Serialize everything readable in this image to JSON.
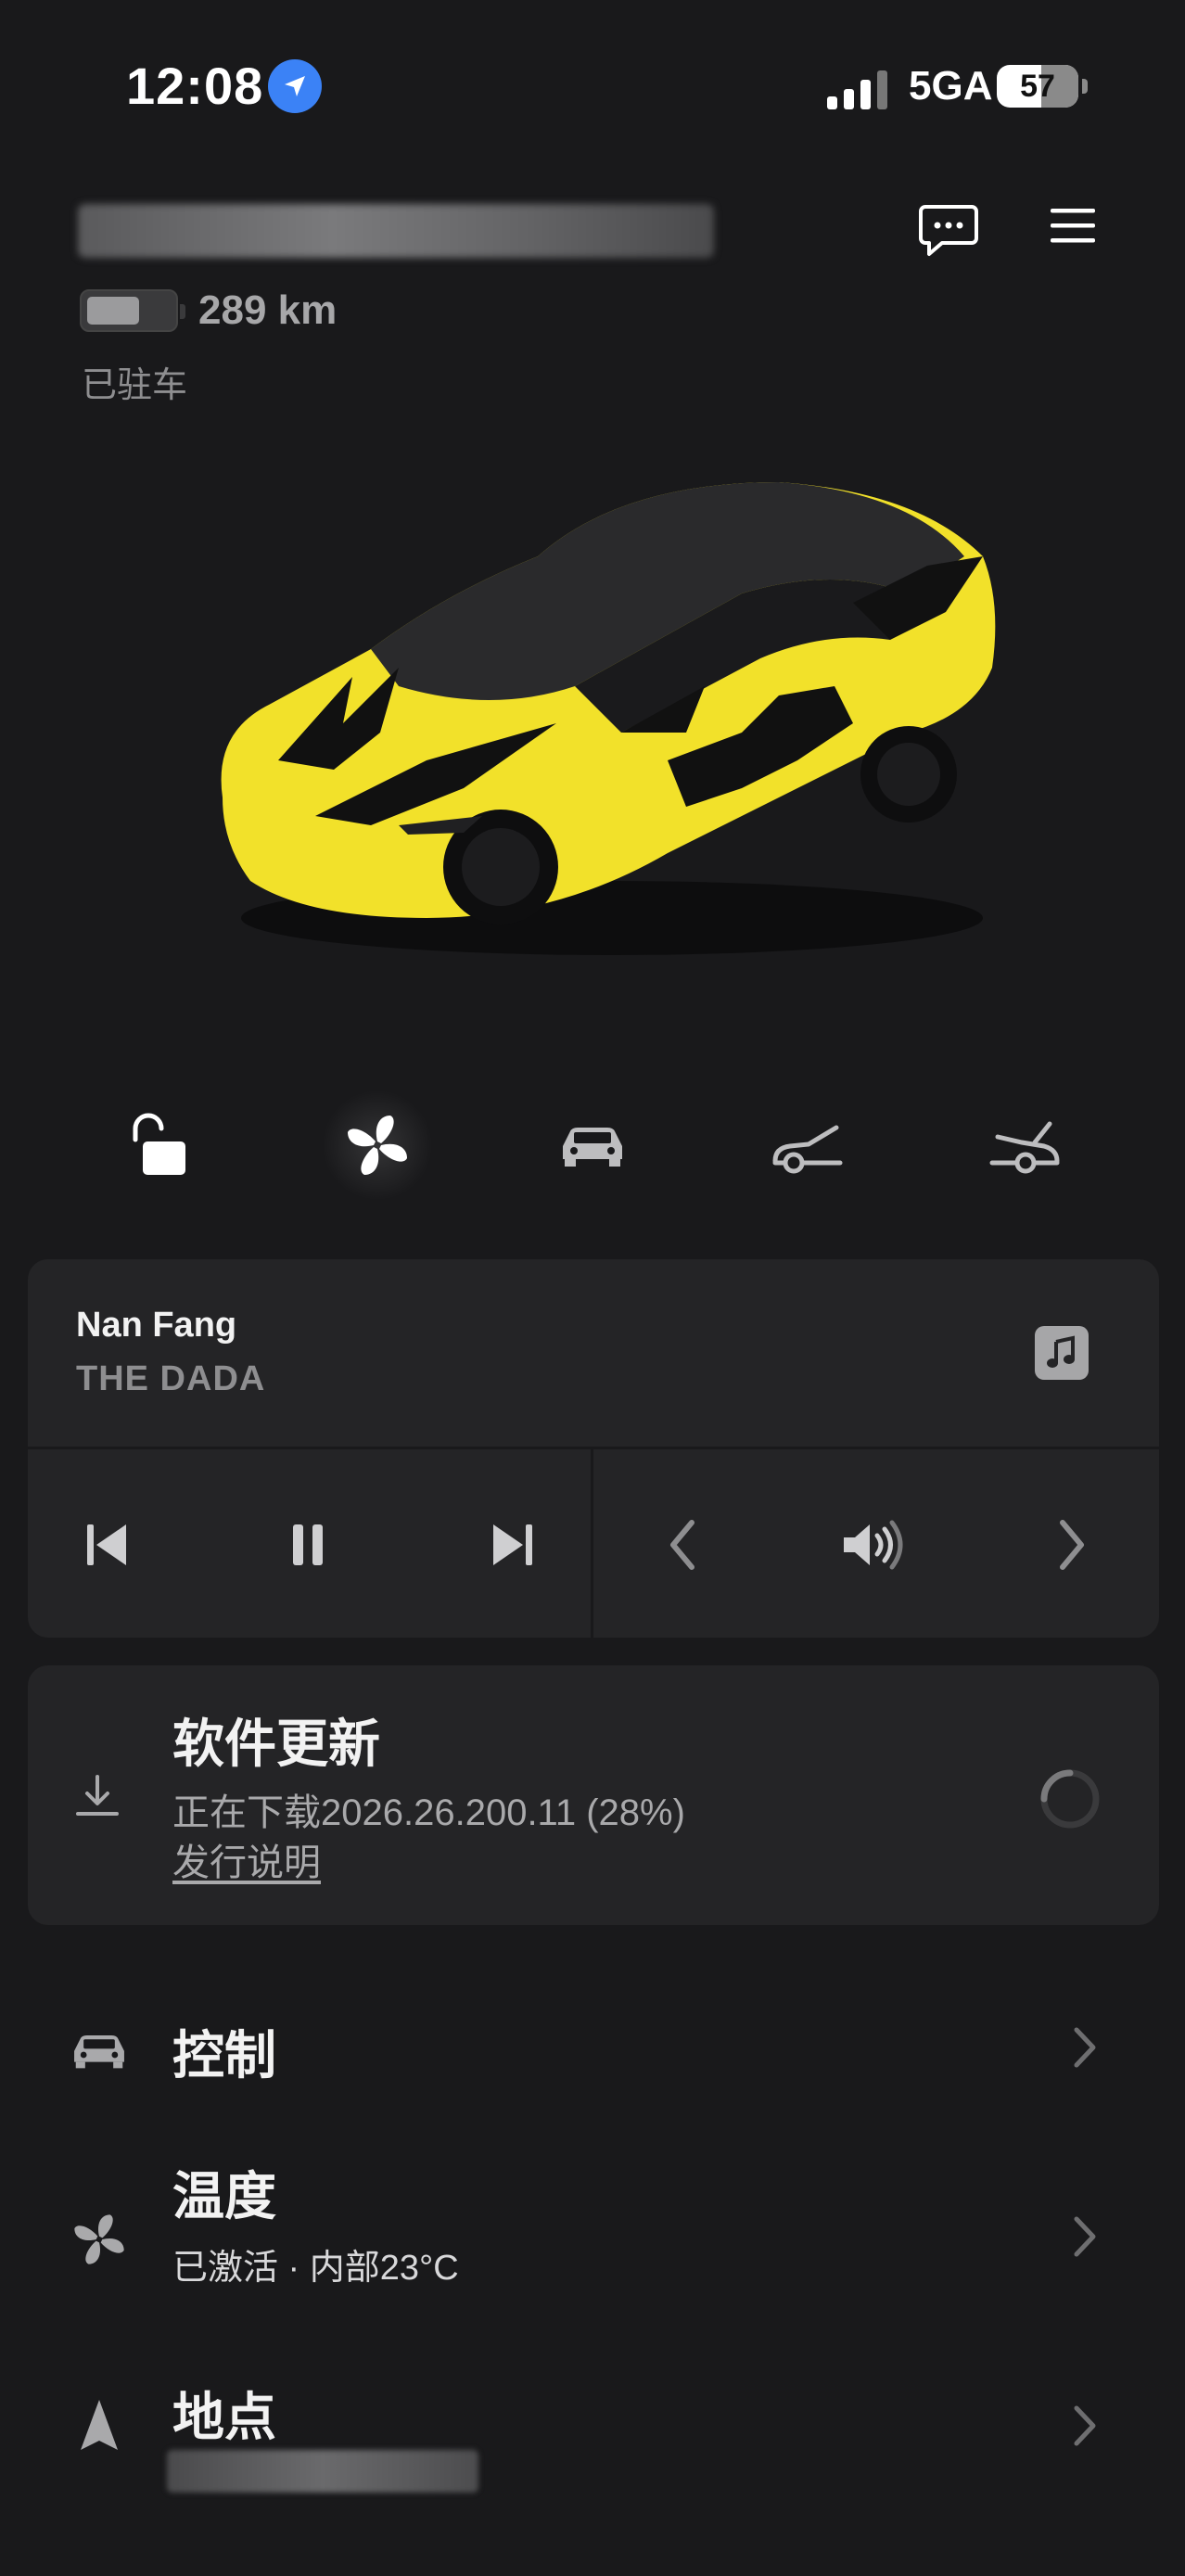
{
  "status_bar": {
    "time": "12:08",
    "network": "5GA",
    "battery_percent": "57"
  },
  "vehicle": {
    "range": "289 km",
    "state": "已驻车",
    "paint_colors": {
      "primary": "#f2e12a",
      "accent": "#111111"
    }
  },
  "quick_actions": [
    {
      "name": "unlock-icon"
    },
    {
      "name": "fan-icon"
    },
    {
      "name": "car-icon"
    },
    {
      "name": "frunk-icon"
    },
    {
      "name": "trunk-icon"
    }
  ],
  "media": {
    "song": "Nan Fang",
    "artist": "THE DADA",
    "source_icon": "music-note-icon"
  },
  "software_update": {
    "title": "软件更新",
    "status": "正在下载2026.26.200.11 (28%)",
    "progress": 0.28,
    "release_notes": "发行说明"
  },
  "menu": {
    "controls": {
      "title": "控制"
    },
    "climate": {
      "title": "温度",
      "subtitle": "已激活 · 内部23°C"
    },
    "location": {
      "title": "地点"
    }
  },
  "colors": {
    "background": "#19191b",
    "card": "#242426",
    "location_badge": "#3b82f6"
  }
}
